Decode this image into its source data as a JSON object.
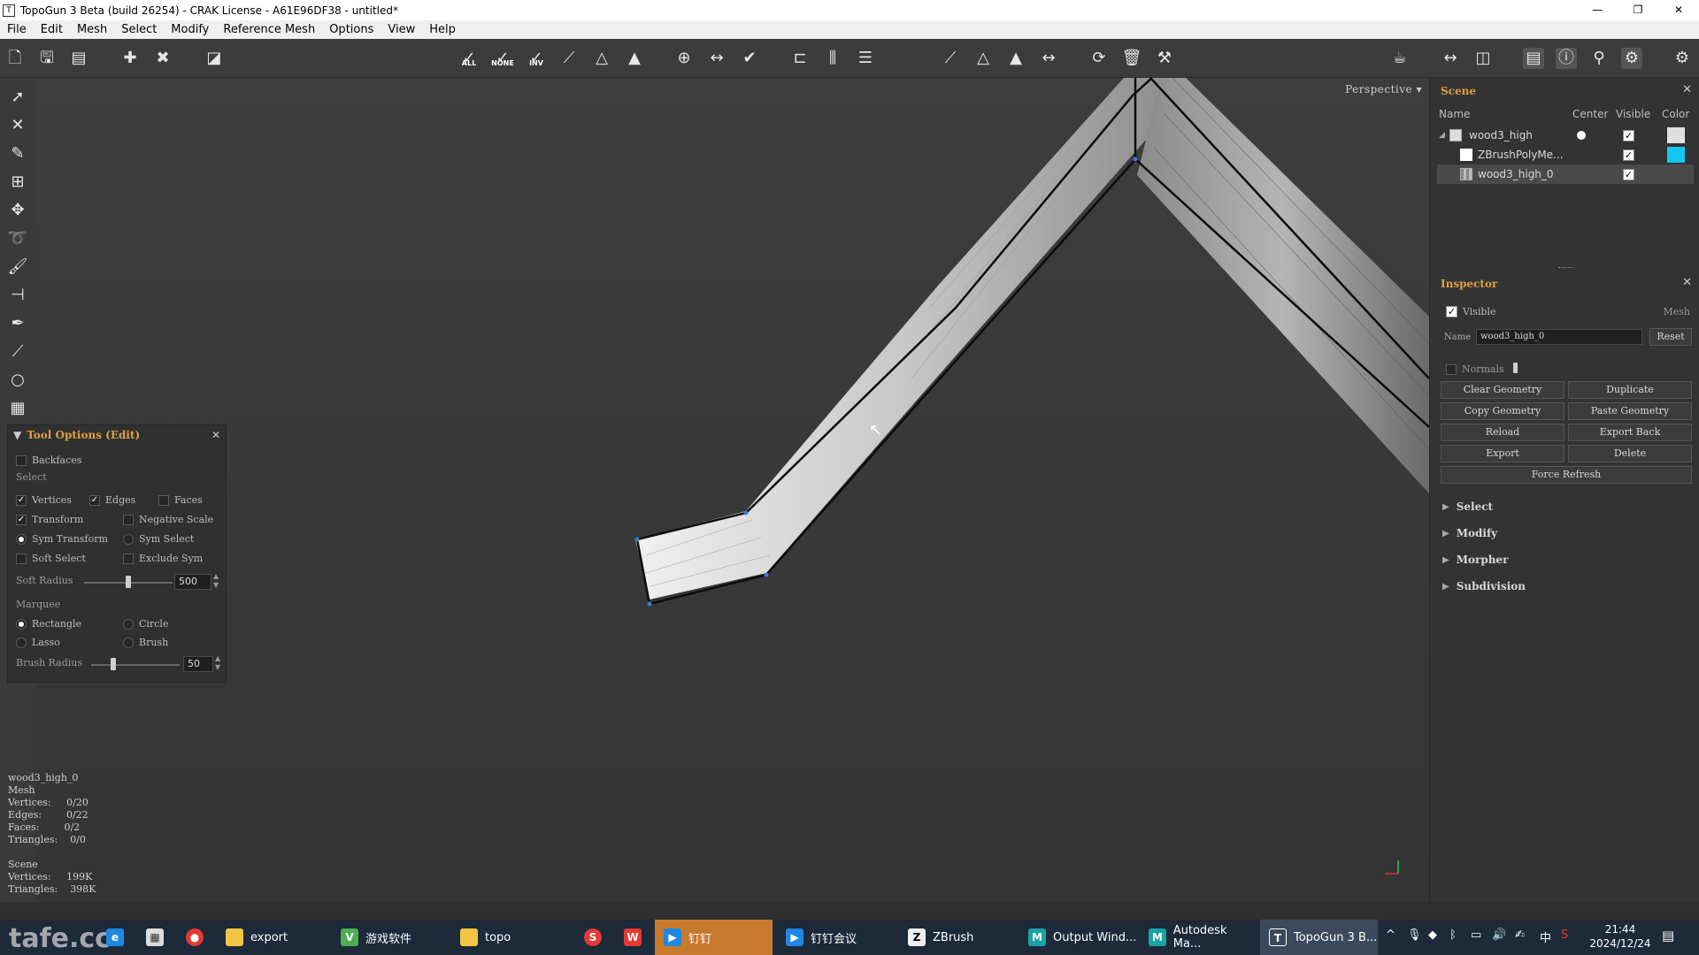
{
  "window": {
    "title": "TopoGun 3 Beta (build 26254) - CRAK License - A61E96DF38 - untitled*",
    "minimize": "—",
    "maximize": "❐",
    "close": "✕"
  },
  "menu": [
    "File",
    "Edit",
    "Mesh",
    "Select",
    "Modify",
    "Reference Mesh",
    "Options",
    "View",
    "Help"
  ],
  "toolbar": {
    "select_all_label": "ALL",
    "select_none_label": "NONE",
    "select_inv_label": "INV"
  },
  "viewport": {
    "mode": "Perspective"
  },
  "tool_options": {
    "title": "Tool Options (Edit)",
    "close": "✕",
    "backfaces": "Backfaces",
    "select_section": "Select",
    "vertices": "Vertices",
    "edges": "Edges",
    "faces": "Faces",
    "transform": "Transform",
    "negative_scale": "Negative Scale",
    "sym_transform": "Sym Transform",
    "sym_select": "Sym Select",
    "soft_select": "Soft Select",
    "exclude_sym": "Exclude Sym",
    "soft_radius_label": "Soft Radius",
    "soft_radius_value": "500",
    "soft_radius_fraction": 0.5,
    "marquee_section": "Marquee",
    "rectangle": "Rectangle",
    "circle": "Circle",
    "lasso": "Lasso",
    "brush": "Brush",
    "brush_radius_label": "Brush Radius",
    "brush_radius_value": "50",
    "brush_radius_fraction": 0.25
  },
  "stats": {
    "object": "wood3_high_0",
    "type": "Mesh",
    "vertices_label": "Vertices:",
    "vertices_value": "0/20",
    "edges_label": "Edges:",
    "edges_value": "0/22",
    "faces_label": "Faces:",
    "faces_value": "0/2",
    "triangles_label": "Triangles:",
    "triangles_value": "0/0",
    "scene_label": "Scene",
    "scene_vertices_label": "Vertices:",
    "scene_vertices_value": "199K",
    "scene_triangles_label": "Triangles:",
    "scene_triangles_value": "398K"
  },
  "scene": {
    "title": "Scene",
    "close": "✕",
    "col_name": "Name",
    "col_center": "Center",
    "col_visible": "Visible",
    "col_color": "Color",
    "rows": [
      {
        "name": "wood3_high",
        "color": "#e0e0e0"
      },
      {
        "name": "ZBrushPolyMe...",
        "color": "#12c8ee"
      },
      {
        "name": "wood3_high_0",
        "color": ""
      }
    ]
  },
  "inspector": {
    "title": "Inspector",
    "close": "✕",
    "visible_label": "Visible",
    "type_label": "Mesh",
    "name_label": "Name",
    "name_value": "wood3_high_0",
    "reset": "Reset",
    "normals_label": "Normals",
    "buttons": [
      "Clear Geometry",
      "Duplicate",
      "Copy Geometry",
      "Paste Geometry",
      "Reload",
      "Export Back",
      "Export",
      "Delete"
    ],
    "force_refresh": "Force Refresh",
    "sections": [
      "Select",
      "Modify",
      "Morpher",
      "Subdivision"
    ]
  },
  "taskbar": {
    "items": [
      "export",
      "游戏软件",
      "topo",
      "钉钉",
      "钉钉会议",
      "ZBrush",
      "Output Wind...",
      "Autodesk Ma...",
      "TopoGun 3 B..."
    ],
    "time": "21:44",
    "date": "2024/12/24",
    "ime": "中",
    "watermark": "tafe.cc"
  }
}
